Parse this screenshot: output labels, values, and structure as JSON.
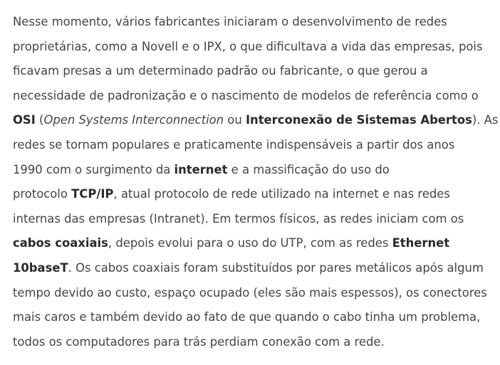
{
  "paragraph": {
    "l1": "Nesse momento, vários fabricantes iniciaram o desenvolvimento de redes",
    "l2": "proprietárias, como a Novell e o IPX, o que dificultava a vida das empresas, pois",
    "l3": "ficavam presas a um determinado padrão ou fabricante, o que gerou a",
    "l4": "necessidade de padronização e o nascimento de modelos de referência como o",
    "l5_osi": "OSI",
    "l5_open": " (",
    "l5_osi_full": "Open Systems Interconnection",
    "l5_ou": " ou ",
    "l5_isa": "Interconexão de Sistemas Abertos",
    "l5_end": "). As",
    "l6": "redes se tornam populares e praticamente indispensáveis a partir dos anos",
    "l7_a": "1990 com o surgimento da ",
    "l7_internet": "internet",
    "l7_b": " e a massificação do uso do",
    "l8_a": "protocolo ",
    "l8_tcpip": "TCP/IP",
    "l8_b": ", atual protocolo de rede utilizado na internet e nas redes",
    "l9": "internas das empresas (Intranet). Em termos físicos, as redes iniciam com os",
    "l10_coax": "cabos coaxiais",
    "l10_b": ", depois evolui para o uso do UTP, com as redes ",
    "l10_ethernet": "Ethernet",
    "l11_10baset": "10baseT",
    "l11_b": ". Os cabos coaxiais foram substituídos por pares metálicos após algum",
    "l12": "tempo devido ao custo, espaço ocupado (eles são mais espessos), os conectores",
    "l13": "mais caros e também devido ao fato de que quando o cabo tinha um problema,",
    "l14": "todos os computadores para trás perdiam conexão com a rede."
  }
}
